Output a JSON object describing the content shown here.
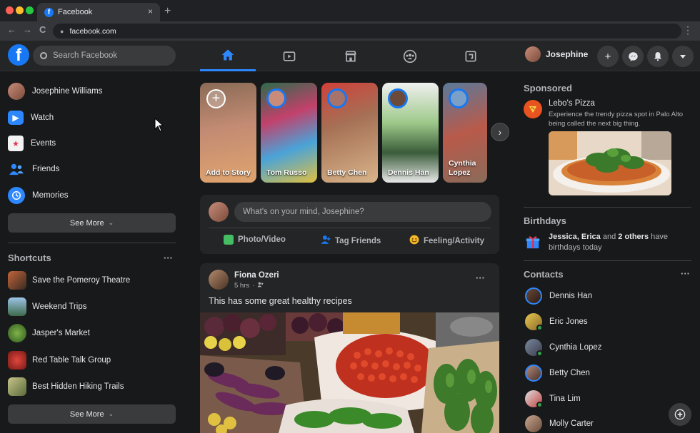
{
  "browser": {
    "tab_title": "Facebook",
    "tab_favicon": "f",
    "tab_close": "×",
    "new_tab": "+",
    "url": "facebook.com",
    "back": "←",
    "forward": "→",
    "reload": "C",
    "menu": "⋮"
  },
  "header": {
    "logo": "f",
    "search_placeholder": "Search Facebook",
    "user_name": "Josephine",
    "nav_tabs": [
      "home-icon",
      "watch-icon",
      "marketplace-icon",
      "groups-icon",
      "gaming-icon"
    ],
    "action_buttons": [
      "plus-icon",
      "messenger-icon",
      "bell-icon",
      "caret-down-icon"
    ]
  },
  "sidebar": {
    "items": [
      {
        "label": "Josephine Williams",
        "icon": "profile-avatar"
      },
      {
        "label": "Watch",
        "icon": "watch-icon"
      },
      {
        "label": "Events",
        "icon": "calendar-icon"
      },
      {
        "label": "Friends",
        "icon": "friends-icon"
      },
      {
        "label": "Memories",
        "icon": "clock-icon"
      }
    ],
    "see_more": "See More",
    "shortcuts_title": "Shortcuts",
    "shortcuts_more": "···",
    "shortcuts": [
      {
        "label": "Save the Pomeroy Theatre"
      },
      {
        "label": "Weekend Trips"
      },
      {
        "label": "Jasper's Market"
      },
      {
        "label": "Red Table Talk Group"
      },
      {
        "label": "Best Hidden Hiking Trails"
      }
    ],
    "see_more_2": "See More"
  },
  "stories": {
    "items": [
      {
        "label": "Add to Story"
      },
      {
        "label": "Tom Russo"
      },
      {
        "label": "Betty Chen"
      },
      {
        "label": "Dennis Han"
      },
      {
        "label": "Cynthia Lopez"
      }
    ]
  },
  "composer": {
    "placeholder": "What's on your mind, Josephine?",
    "actions": [
      "Photo/Video",
      "Tag Friends",
      "Feeling/Activity"
    ]
  },
  "post": {
    "author": "Fiona Ozeri",
    "time": "5 hrs",
    "text": "This has some great healthy recipes",
    "more": "···"
  },
  "sponsored": {
    "title": "Sponsored",
    "name": "Lebo's Pizza",
    "desc": "Experience the trendy pizza spot in Palo Alto being called the next big thing."
  },
  "birthdays": {
    "title": "Birthdays",
    "names": "Jessica, Erica",
    "and": "and",
    "others": "2 others",
    "rest": "have birthdays today"
  },
  "contacts": {
    "title": "Contacts",
    "more": "···",
    "items": [
      {
        "name": "Dennis Han"
      },
      {
        "name": "Eric Jones"
      },
      {
        "name": "Cynthia Lopez"
      },
      {
        "name": "Betty Chen"
      },
      {
        "name": "Tina Lim"
      },
      {
        "name": "Molly Carter"
      }
    ]
  },
  "colors": {
    "accent": "#2d88ff",
    "brand": "#1877f2",
    "bg": "#18191a",
    "card": "#242526"
  }
}
